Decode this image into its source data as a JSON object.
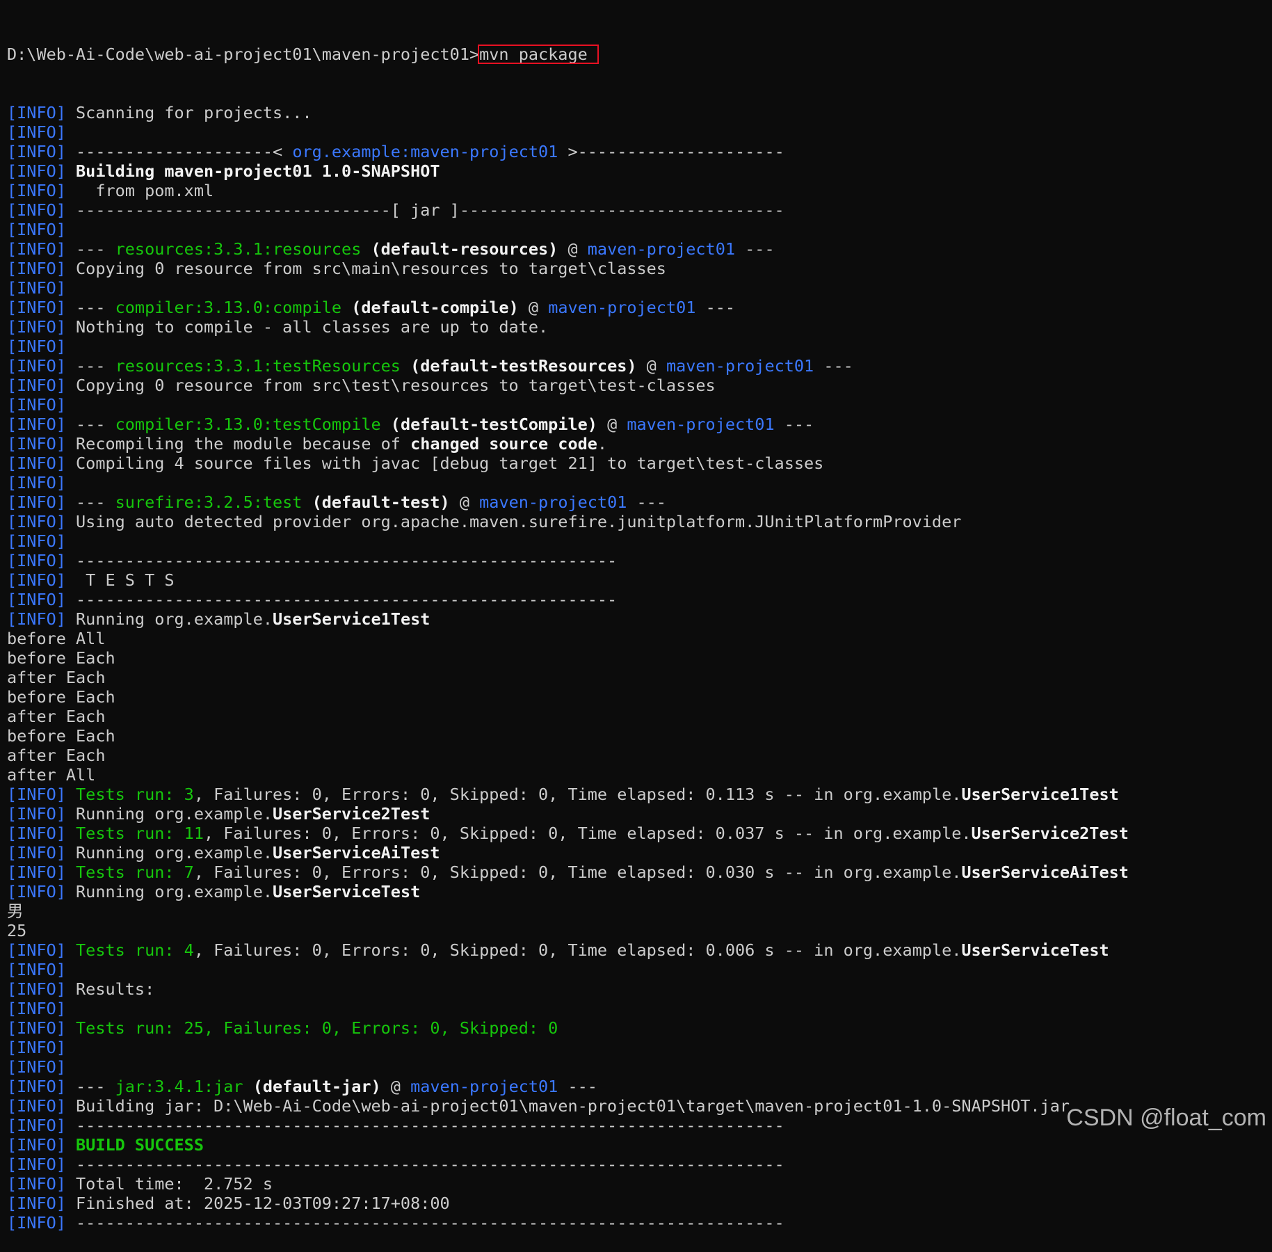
{
  "prompt": {
    "path": "D:\\Web-Ai-Code\\web-ai-project01\\maven-project01>",
    "command": "mvn package"
  },
  "lines": [
    [
      [
        "tag",
        "[INFO]"
      ],
      [
        "t",
        " Scanning for projects..."
      ]
    ],
    [
      [
        "tag",
        "[INFO]"
      ]
    ],
    [
      [
        "tag",
        "[INFO]"
      ],
      [
        "t",
        " --------------------< "
      ],
      [
        "b",
        "org.example:maven-project01"
      ],
      [
        "t",
        " >---------------------"
      ]
    ],
    [
      [
        "tag",
        "[INFO]"
      ],
      [
        "w",
        " Building maven-project01 1.0-SNAPSHOT"
      ]
    ],
    [
      [
        "tag",
        "[INFO]"
      ],
      [
        "t",
        "   from pom.xml"
      ]
    ],
    [
      [
        "tag",
        "[INFO]"
      ],
      [
        "t",
        " --------------------------------[ jar ]---------------------------------"
      ]
    ],
    [
      [
        "tag",
        "[INFO]"
      ]
    ],
    [
      [
        "tag",
        "[INFO]"
      ],
      [
        "t",
        " --- "
      ],
      [
        "g",
        "resources:3.3.1:resources"
      ],
      [
        "w",
        " (default-resources)"
      ],
      [
        "t",
        " @ "
      ],
      [
        "b",
        "maven-project01"
      ],
      [
        "t",
        " ---"
      ]
    ],
    [
      [
        "tag",
        "[INFO]"
      ],
      [
        "t",
        " Copying 0 resource from src\\main\\resources to target\\classes"
      ]
    ],
    [
      [
        "tag",
        "[INFO]"
      ]
    ],
    [
      [
        "tag",
        "[INFO]"
      ],
      [
        "t",
        " --- "
      ],
      [
        "g",
        "compiler:3.13.0:compile"
      ],
      [
        "w",
        " (default-compile)"
      ],
      [
        "t",
        " @ "
      ],
      [
        "b",
        "maven-project01"
      ],
      [
        "t",
        " ---"
      ]
    ],
    [
      [
        "tag",
        "[INFO]"
      ],
      [
        "t",
        " Nothing to compile - all classes are up to date."
      ]
    ],
    [
      [
        "tag",
        "[INFO]"
      ]
    ],
    [
      [
        "tag",
        "[INFO]"
      ],
      [
        "t",
        " --- "
      ],
      [
        "g",
        "resources:3.3.1:testResources"
      ],
      [
        "w",
        " (default-testResources)"
      ],
      [
        "t",
        " @ "
      ],
      [
        "b",
        "maven-project01"
      ],
      [
        "t",
        " ---"
      ]
    ],
    [
      [
        "tag",
        "[INFO]"
      ],
      [
        "t",
        " Copying 0 resource from src\\test\\resources to target\\test-classes"
      ]
    ],
    [
      [
        "tag",
        "[INFO]"
      ]
    ],
    [
      [
        "tag",
        "[INFO]"
      ],
      [
        "t",
        " --- "
      ],
      [
        "g",
        "compiler:3.13.0:testCompile"
      ],
      [
        "w",
        " (default-testCompile)"
      ],
      [
        "t",
        " @ "
      ],
      [
        "b",
        "maven-project01"
      ],
      [
        "t",
        " ---"
      ]
    ],
    [
      [
        "tag",
        "[INFO]"
      ],
      [
        "t",
        " Recompiling the module because of "
      ],
      [
        "w",
        "changed source code"
      ],
      [
        "t",
        "."
      ]
    ],
    [
      [
        "tag",
        "[INFO]"
      ],
      [
        "t",
        " Compiling 4 source files with javac [debug target 21] to target\\test-classes"
      ]
    ],
    [
      [
        "tag",
        "[INFO]"
      ]
    ],
    [
      [
        "tag",
        "[INFO]"
      ],
      [
        "t",
        " --- "
      ],
      [
        "g",
        "surefire:3.2.5:test"
      ],
      [
        "w",
        " (default-test)"
      ],
      [
        "t",
        " @ "
      ],
      [
        "b",
        "maven-project01"
      ],
      [
        "t",
        " ---"
      ]
    ],
    [
      [
        "tag",
        "[INFO]"
      ],
      [
        "t",
        " Using auto detected provider org.apache.maven.surefire.junitplatform.JUnitPlatformProvider"
      ]
    ],
    [
      [
        "tag",
        "[INFO]"
      ]
    ],
    [
      [
        "tag",
        "[INFO]"
      ],
      [
        "t",
        " -------------------------------------------------------"
      ]
    ],
    [
      [
        "tag",
        "[INFO]"
      ],
      [
        "t",
        "  T E S T S"
      ]
    ],
    [
      [
        "tag",
        "[INFO]"
      ],
      [
        "t",
        " -------------------------------------------------------"
      ]
    ],
    [
      [
        "tag",
        "[INFO]"
      ],
      [
        "t",
        " Running org.example."
      ],
      [
        "w",
        "UserService1Test"
      ]
    ],
    [
      [
        "t",
        "before All"
      ]
    ],
    [
      [
        "t",
        "before Each"
      ]
    ],
    [
      [
        "t",
        "after Each"
      ]
    ],
    [
      [
        "t",
        "before Each"
      ]
    ],
    [
      [
        "t",
        "after Each"
      ]
    ],
    [
      [
        "t",
        "before Each"
      ]
    ],
    [
      [
        "t",
        "after Each"
      ]
    ],
    [
      [
        "t",
        "after All"
      ]
    ],
    [
      [
        "tag",
        "[INFO]"
      ],
      [
        "g",
        " Tests run: 3"
      ],
      [
        "t",
        ", Failures: 0, Errors: 0, Skipped: 0, Time elapsed: 0.113 s -- in org.example."
      ],
      [
        "w",
        "UserService1Test"
      ]
    ],
    [
      [
        "tag",
        "[INFO]"
      ],
      [
        "t",
        " Running org.example."
      ],
      [
        "w",
        "UserService2Test"
      ]
    ],
    [
      [
        "tag",
        "[INFO]"
      ],
      [
        "g",
        " Tests run: 11"
      ],
      [
        "t",
        ", Failures: 0, Errors: 0, Skipped: 0, Time elapsed: 0.037 s -- in org.example."
      ],
      [
        "w",
        "UserService2Test"
      ]
    ],
    [
      [
        "tag",
        "[INFO]"
      ],
      [
        "t",
        " Running org.example."
      ],
      [
        "w",
        "UserServiceAiTest"
      ]
    ],
    [
      [
        "tag",
        "[INFO]"
      ],
      [
        "g",
        " Tests run: 7"
      ],
      [
        "t",
        ", Failures: 0, Errors: 0, Skipped: 0, Time elapsed: 0.030 s -- in org.example."
      ],
      [
        "w",
        "UserServiceAiTest"
      ]
    ],
    [
      [
        "tag",
        "[INFO]"
      ],
      [
        "t",
        " Running org.example."
      ],
      [
        "w",
        "UserServiceTest"
      ]
    ],
    [
      [
        "t",
        "男"
      ]
    ],
    [
      [
        "t",
        "25"
      ]
    ],
    [
      [
        "tag",
        "[INFO]"
      ],
      [
        "g",
        " Tests run: 4"
      ],
      [
        "t",
        ", Failures: 0, Errors: 0, Skipped: 0, Time elapsed: 0.006 s -- in org.example."
      ],
      [
        "w",
        "UserServiceTest"
      ]
    ],
    [
      [
        "tag",
        "[INFO]"
      ]
    ],
    [
      [
        "tag",
        "[INFO]"
      ],
      [
        "t",
        " Results:"
      ]
    ],
    [
      [
        "tag",
        "[INFO]"
      ]
    ],
    [
      [
        "tag",
        "[INFO]"
      ],
      [
        "g",
        " Tests run: 25, Failures: 0, Errors: 0, Skipped: 0"
      ]
    ],
    [
      [
        "tag",
        "[INFO]"
      ]
    ],
    [
      [
        "tag",
        "[INFO]"
      ]
    ],
    [
      [
        "tag",
        "[INFO]"
      ],
      [
        "t",
        " --- "
      ],
      [
        "g",
        "jar:3.4.1:jar"
      ],
      [
        "w",
        " (default-jar)"
      ],
      [
        "t",
        " @ "
      ],
      [
        "b",
        "maven-project01"
      ],
      [
        "t",
        " ---"
      ]
    ],
    [
      [
        "tag",
        "[INFO]"
      ],
      [
        "t",
        " Building jar: D:\\Web-Ai-Code\\web-ai-project01\\maven-project01\\target\\maven-project01-1.0-SNAPSHOT.jar"
      ]
    ],
    [
      [
        "tag",
        "[INFO]"
      ],
      [
        "t",
        " ------------------------------------------------------------------------"
      ]
    ],
    [
      [
        "tag",
        "[INFO]"
      ],
      [
        "gb",
        " BUILD SUCCESS"
      ]
    ],
    [
      [
        "tag",
        "[INFO]"
      ],
      [
        "t",
        " ------------------------------------------------------------------------"
      ]
    ],
    [
      [
        "tag",
        "[INFO]"
      ],
      [
        "t",
        " Total time:  2.752 s"
      ]
    ],
    [
      [
        "tag",
        "[INFO]"
      ],
      [
        "t",
        " Finished at: 2025-12-03T09:27:17+08:00"
      ]
    ],
    [
      [
        "tag",
        "[INFO]"
      ],
      [
        "t",
        " ------------------------------------------------------------------------"
      ]
    ]
  ],
  "watermark": "CSDN @float_com",
  "colors": {
    "background": "#0c0c0c",
    "text": "#cccccc",
    "bright_text": "#f2f2f2",
    "info_tag": "#3b78ff",
    "plugin_green": "#16c60c",
    "artifact_blue": "#3b78ff",
    "command_highlight_box": "#e81123"
  }
}
